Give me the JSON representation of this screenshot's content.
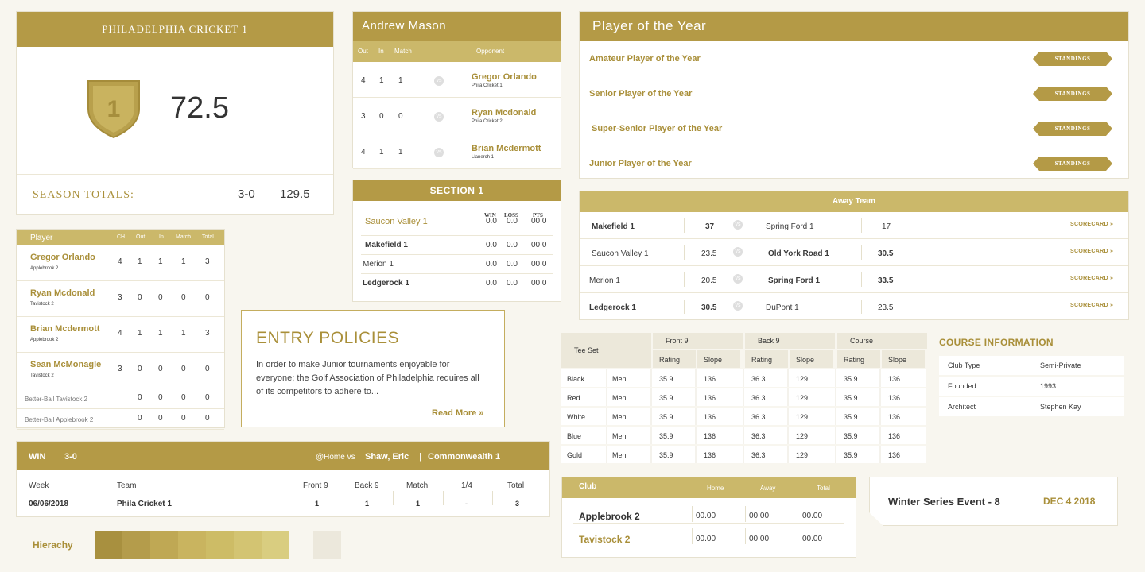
{
  "club": {
    "title": "PHILADELPHIA CRICKET 1",
    "rank": "1",
    "score": "72.5",
    "totals_label": "SEASON TOTALS:",
    "record": "3-0",
    "points": "129.5"
  },
  "player_card": {
    "name": "Andrew Mason",
    "headers": [
      "Out",
      "In",
      "Match",
      "Opponent"
    ],
    "rows": [
      {
        "out": "4",
        "in": "1",
        "match": "1",
        "name": "Gregor Orlando",
        "club": "Phila Cricket 1"
      },
      {
        "out": "3",
        "in": "0",
        "match": "0",
        "name": "Ryan Mcdonald",
        "club": "Phila Cricket 2"
      },
      {
        "out": "4",
        "in": "1",
        "match": "1",
        "name": "Brian Mcdermott",
        "club": "Llanerch 1"
      }
    ]
  },
  "poy": {
    "title": "Player of the Year",
    "button": "STANDINGS",
    "items": [
      "Amateur Player of the Year",
      "Senior Player of the Year",
      "Super-Senior Player of the Year",
      "Junior Player of the Year"
    ]
  },
  "players_table": {
    "headers": [
      "Player",
      "CH",
      "Out",
      "In",
      "Match",
      "Total"
    ],
    "rows": [
      {
        "name": "Gregor Orlando",
        "club": "Applebrook 2",
        "vals": [
          "4",
          "1",
          "1",
          "1",
          "3"
        ]
      },
      {
        "name": "Ryan Mcdonald",
        "club": "Tavistock 2",
        "vals": [
          "3",
          "0",
          "0",
          "0",
          "0"
        ]
      },
      {
        "name": "Brian Mcdermott",
        "club": "Applebrook 2",
        "vals": [
          "4",
          "1",
          "1",
          "1",
          "3"
        ]
      },
      {
        "name": "Sean McMonagle",
        "club": "Tavistock 2",
        "vals": [
          "3",
          "0",
          "0",
          "0",
          "0"
        ]
      }
    ],
    "bb": [
      {
        "name": "Better-Ball Tavistock 2",
        "vals": [
          "0",
          "0",
          "0",
          "0"
        ]
      },
      {
        "name": "Better-Ball Applebrook 2",
        "vals": [
          "0",
          "0",
          "0",
          "0"
        ]
      }
    ]
  },
  "section": {
    "title": "SECTION 1",
    "headers": [
      "WIN",
      "LOSS",
      "PTS"
    ],
    "rows": [
      {
        "name": "Saucon Valley 1",
        "vals": [
          "0.0",
          "0.0",
          "00.0"
        ]
      },
      {
        "name": "Makefield 1",
        "vals": [
          "0.0",
          "0.0",
          "00.0"
        ]
      },
      {
        "name": "Merion 1",
        "vals": [
          "0.0",
          "0.0",
          "00.0"
        ]
      },
      {
        "name": "Ledgerock 1",
        "vals": [
          "0.0",
          "0.0",
          "00.0"
        ]
      }
    ]
  },
  "away": {
    "title": "Away Team",
    "scorecard": "SCORECARD »",
    "rows": [
      {
        "a": "Makefield 1",
        "as": "37",
        "b": "Spring Ford 1",
        "bs": "17",
        "abold": true,
        "bbold": false
      },
      {
        "a": "Saucon Valley 1",
        "as": "23.5",
        "b": "Old York Road 1",
        "bs": "30.5",
        "abold": false,
        "bbold": true
      },
      {
        "a": "Merion 1",
        "as": "20.5",
        "b": "Spring Ford 1",
        "bs": "33.5",
        "abold": false,
        "bbold": true
      },
      {
        "a": "Ledgerock 1",
        "as": "30.5",
        "b": "DuPont 1",
        "bs": "23.5",
        "abold": true,
        "bbold": false
      }
    ]
  },
  "entry": {
    "title": "ENTRY POLICIES",
    "body": "In order to make Junior tournaments enjoyable for everyone; the Golf Association of Philadelphia requires all of its competitors to adhere to...",
    "link": "Read More »"
  },
  "tee": {
    "headers": [
      "Tee Set",
      "Front 9",
      "Back 9",
      "Course"
    ],
    "sub": [
      "Rating",
      "Slope",
      "Rating",
      "Slope",
      "Rating",
      "Slope"
    ],
    "rows": [
      {
        "color": "Black",
        "gender": "Men",
        "vals": [
          "35.9",
          "136",
          "36.3",
          "129",
          "35.9",
          "136"
        ]
      },
      {
        "color": "Red",
        "gender": "Men",
        "vals": [
          "35.9",
          "136",
          "36.3",
          "129",
          "35.9",
          "136"
        ]
      },
      {
        "color": "White",
        "gender": "Men",
        "vals": [
          "35.9",
          "136",
          "36.3",
          "129",
          "35.9",
          "136"
        ]
      },
      {
        "color": "Blue",
        "gender": "Men",
        "vals": [
          "35.9",
          "136",
          "36.3",
          "129",
          "35.9",
          "136"
        ]
      },
      {
        "color": "Gold",
        "gender": "Men",
        "vals": [
          "35.9",
          "136",
          "36.3",
          "129",
          "35.9",
          "136"
        ]
      }
    ]
  },
  "course_info": {
    "title": "COURSE INFORMATION",
    "rows": [
      {
        "k": "Club Type",
        "v": "Semi-Private"
      },
      {
        "k": "Founded",
        "v": "1993"
      },
      {
        "k": "Architect",
        "v": "Stephen Kay"
      }
    ]
  },
  "match": {
    "result": "WIN",
    "sep": "|",
    "record": "3-0",
    "at": "@Home vs",
    "opponent": "Shaw, Eric",
    "club": "Commonwealth 1",
    "headers": [
      "Week",
      "Team",
      "Front 9",
      "Back 9",
      "Match",
      "1/4",
      "Total"
    ],
    "vals": [
      "06/06/2018",
      "Phila Cricket 1",
      "1",
      "1",
      "1",
      "-",
      "3"
    ]
  },
  "club_scores": {
    "headers": [
      "Club",
      "Home",
      "Away",
      "Total"
    ],
    "rows": [
      {
        "name": "Applebrook 2",
        "vals": [
          "00.00",
          "00.00",
          "00.00"
        ]
      },
      {
        "name": "Tavistock 2",
        "vals": [
          "00.00",
          "00.00",
          "00.00"
        ]
      }
    ]
  },
  "event": {
    "name": "Winter Series Event - 8",
    "date": "DEC 4 2018"
  },
  "hierarchy": {
    "label": "Hierachy",
    "swatches": [
      "#a8903f",
      "#b49c4b",
      "#bfa854",
      "#c9b45f",
      "#cdbc66",
      "#d3c472",
      "#d9cd80"
    ],
    "light": "#ece8dc"
  }
}
